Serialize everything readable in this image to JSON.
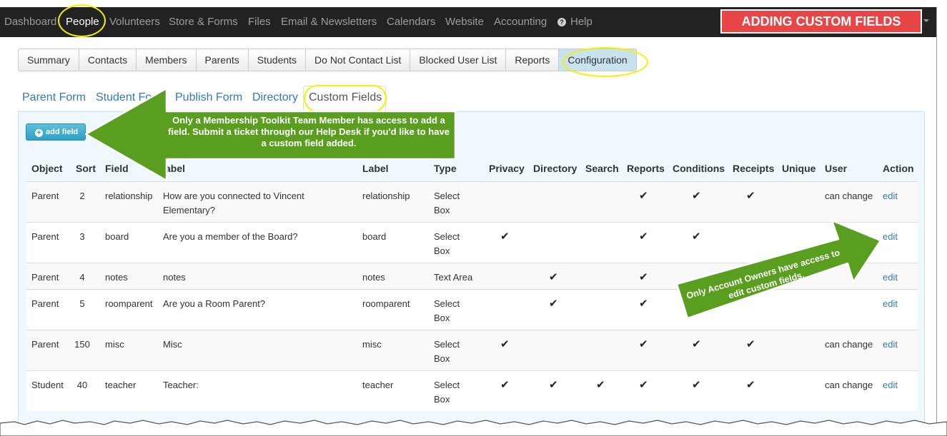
{
  "nav": {
    "items": [
      "Dashboard",
      "People",
      "Volunteers",
      "Store & Forms",
      "Files",
      "Email & Newsletters",
      "Calendars",
      "Website",
      "Accounting",
      "Help"
    ],
    "active": "People",
    "banner": "ADDING CUSTOM FIELDS"
  },
  "tabs": [
    "Summary",
    "Contacts",
    "Members",
    "Parents",
    "Students",
    "Do Not Contact List",
    "Blocked User List",
    "Reports",
    "Configuration"
  ],
  "active_tab": "Configuration",
  "subnav": [
    "Parent Form",
    "Student Form",
    "Publish Form",
    "Directory",
    "Custom Fields"
  ],
  "subnav_visible": {
    "student_form": "Student Fo"
  },
  "active_subnav": "Custom Fields",
  "add_button": "add field",
  "table": {
    "headers": [
      "Object",
      "Sort",
      "Field",
      "Label",
      "Label",
      "Type",
      "Privacy",
      "Directory",
      "Search",
      "Reports",
      "Conditions",
      "Receipts",
      "Unique",
      "User",
      "Action"
    ],
    "header_visible_label1": "abel",
    "rows": [
      {
        "object": "Parent",
        "sort": "2",
        "field": "relationship",
        "label_long": "How are you connected to Vincent Elementary?",
        "label": "relationship",
        "type": "Select Box",
        "privacy": false,
        "directory": false,
        "search": false,
        "reports": true,
        "conditions": true,
        "receipts": true,
        "unique": false,
        "user": "can change",
        "action": "edit"
      },
      {
        "object": "Parent",
        "sort": "3",
        "field": "board",
        "label_long": "Are you a member of the Board?",
        "label": "board",
        "type": "Select Box",
        "privacy": true,
        "directory": false,
        "search": false,
        "reports": true,
        "conditions": true,
        "receipts": false,
        "unique": false,
        "user": "",
        "action": "edit"
      },
      {
        "object": "Parent",
        "sort": "4",
        "field": "notes",
        "label_long": "notes",
        "label": "notes",
        "type": "Text Area",
        "privacy": false,
        "directory": true,
        "search": false,
        "reports": true,
        "conditions": false,
        "receipts": false,
        "unique": false,
        "user": "",
        "action": "edit"
      },
      {
        "object": "Parent",
        "sort": "5",
        "field": "roomparent",
        "label_long": "Are you a Room Parent?",
        "label": "roomparent",
        "type": "Select Box",
        "privacy": false,
        "directory": true,
        "search": false,
        "reports": true,
        "conditions": false,
        "receipts": false,
        "unique": false,
        "user": "",
        "action": "edit"
      },
      {
        "object": "Parent",
        "sort": "150",
        "field": "misc",
        "label_long": "Misc",
        "label": "misc",
        "type": "Select Box",
        "privacy": true,
        "directory": false,
        "search": false,
        "reports": true,
        "conditions": true,
        "receipts": true,
        "unique": false,
        "user": "can change",
        "action": "edit"
      },
      {
        "object": "Student",
        "sort": "40",
        "field": "teacher",
        "label_long": "Teacher:",
        "label": "teacher",
        "type": "Select Box",
        "privacy": true,
        "directory": true,
        "search": true,
        "reports": true,
        "conditions": true,
        "receipts": true,
        "unique": false,
        "user": "can change",
        "action": "edit"
      }
    ]
  },
  "callouts": {
    "left": "Only a Membership Toolkit Team Member has access to add a field.  Submit a ticket through our Help Desk if you'd like to have a custom field added.",
    "right": "Only Account Owners have access to edit custom fields."
  },
  "colors": {
    "nav_bg": "#222222",
    "banner": "#e84646",
    "highlight": "#f5f000",
    "callout": "#5a9e1f",
    "link": "#337ab7",
    "panel": "#eff9fd"
  }
}
